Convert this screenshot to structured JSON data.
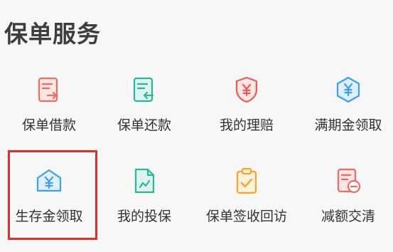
{
  "page": {
    "title": "保单服务"
  },
  "services": [
    {
      "label": "保单借款",
      "icon": "loan-document-icon",
      "color": "#ef6b63"
    },
    {
      "label": "保单还款",
      "icon": "repay-document-icon",
      "color": "#2bb59a"
    },
    {
      "label": "我的理赔",
      "icon": "claim-shield-yen-icon",
      "color": "#ef5a50"
    },
    {
      "label": "满期金领取",
      "icon": "maturity-hexagon-yen-icon",
      "color": "#3d9ef5"
    },
    {
      "label": "生存金领取",
      "icon": "survival-envelope-yen-icon",
      "color": "#3d9ef5"
    },
    {
      "label": "我的投保",
      "icon": "my-application-document-icon",
      "color": "#2bb59a"
    },
    {
      "label": "保单签收回访",
      "icon": "receipt-clipboard-check-icon",
      "color": "#f5a623"
    },
    {
      "label": "减额交清",
      "icon": "reduced-paid-up-document-icon",
      "color": "#ef6b63"
    }
  ],
  "highlight": {
    "color": "#d9322b",
    "target": "生存金领取"
  }
}
